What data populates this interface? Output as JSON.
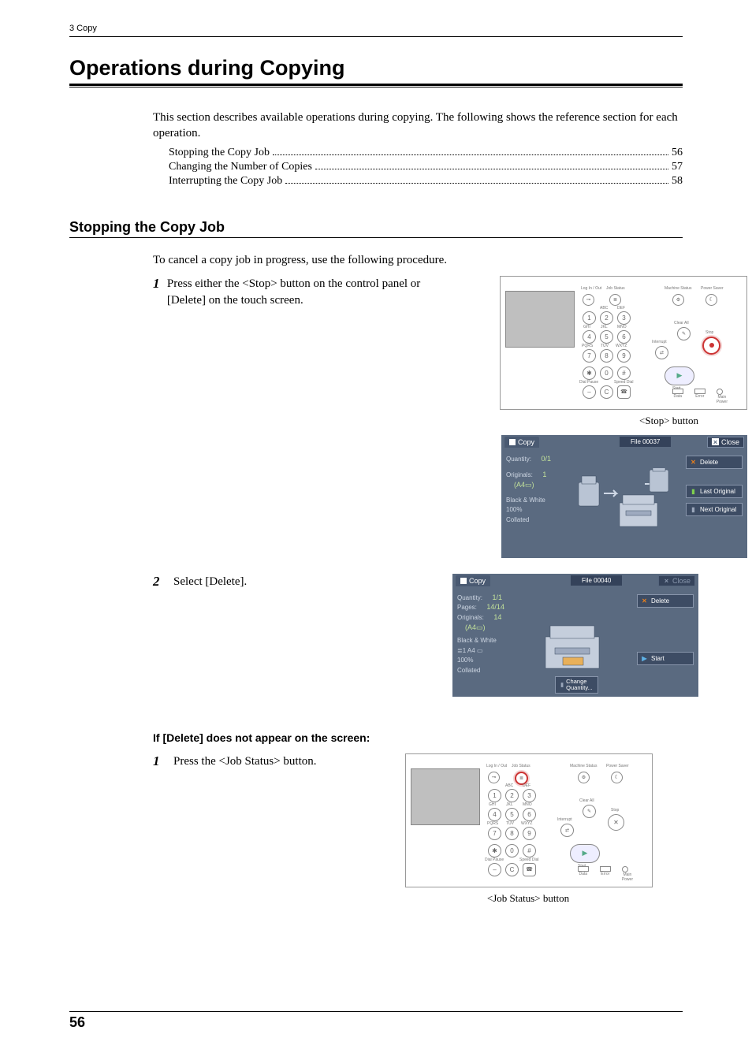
{
  "running_head": "3 Copy",
  "h1": "Operations during Copying",
  "intro": "This section describes available operations during copying. The following shows the reference section for each operation.",
  "toc": [
    {
      "title": "Stopping the Copy Job",
      "page": "56"
    },
    {
      "title": "Changing the Number of Copies",
      "page": "57"
    },
    {
      "title": "Interrupting the Copy Job",
      "page": "58"
    }
  ],
  "h2": "Stopping the Copy Job",
  "h2_intro": "To cancel a copy job in progress, use the following procedure.",
  "steps": [
    {
      "num": "1",
      "text": "Press either the <Stop> button on the control panel or [Delete] on the touch screen."
    },
    {
      "num": "2",
      "text": "Select [Delete]."
    }
  ],
  "panel1": {
    "caption": "<Stop> button",
    "top_labels": {
      "login": "Log In / Out",
      "jobstatus": "Job Status",
      "machine": "Machine Status",
      "power": "Power Saver"
    },
    "key_labels": {
      "r1": [
        "ABC",
        "DEF"
      ],
      "r2": [
        "GHI",
        "JKL",
        "MNO"
      ],
      "r3": [
        "PQRS",
        "TUV",
        "WXYZ"
      ]
    },
    "keys": [
      [
        "1",
        "2",
        "3"
      ],
      [
        "4",
        "5",
        "6"
      ],
      [
        "7",
        "8",
        "9"
      ],
      [
        "✱",
        "0",
        "#"
      ]
    ],
    "dialpause": "Dial Pause",
    "speeddial": "Speed Dial",
    "clearall": "Clear All",
    "interrupt": "Interrupt",
    "stop": "Stop",
    "start": "Start",
    "leds": {
      "data": "Data",
      "error": "Error",
      "main": "Main\nPower"
    },
    "highlight": "stop"
  },
  "ts1": {
    "tab": "Copy",
    "file": "File 00037",
    "close": "Close",
    "left": [
      {
        "lbl": "Quantity:",
        "val": "0/1"
      },
      {
        "lbl": "Originals:",
        "val": "1"
      },
      {
        "lbl": "",
        "val": "(A4▭)"
      },
      {
        "lbl": "Black & White",
        "val": ""
      },
      {
        "lbl": "100%",
        "val": ""
      },
      {
        "lbl": "Collated",
        "val": ""
      }
    ],
    "right": [
      {
        "icon": "x-red",
        "label": "Delete"
      },
      {
        "icon": "x-grn",
        "label": "Last Original"
      },
      {
        "icon": "x-gry",
        "label": "Next Original"
      }
    ]
  },
  "ts2": {
    "tab": "Copy",
    "file": "File 00040",
    "close": "Close",
    "close_dim": true,
    "left": [
      {
        "lbl": "Quantity:",
        "val": "1/1"
      },
      {
        "lbl": "Pages:",
        "val": "14/14"
      },
      {
        "lbl": "Originals:",
        "val": "14"
      },
      {
        "lbl": "",
        "val": "(A4▭)"
      },
      {
        "lbl": "Black & White",
        "val": ""
      },
      {
        "lbl": "≣1  A4 ▭",
        "val": ""
      },
      {
        "lbl": "100%",
        "val": ""
      },
      {
        "lbl": "Collated",
        "val": ""
      }
    ],
    "right": [
      {
        "icon": "x-red",
        "label": "Delete"
      },
      {
        "icon": "x-blu",
        "label": "Start"
      }
    ],
    "bottom": {
      "label": "Change\nQuantity..."
    }
  },
  "h3": "If [Delete] does not appear on the screen:",
  "steps2": [
    {
      "num": "1",
      "text": "Press the <Job Status> button."
    }
  ],
  "panel2": {
    "caption": "<Job Status> button",
    "highlight": "jobstatus"
  },
  "page_number": "56"
}
